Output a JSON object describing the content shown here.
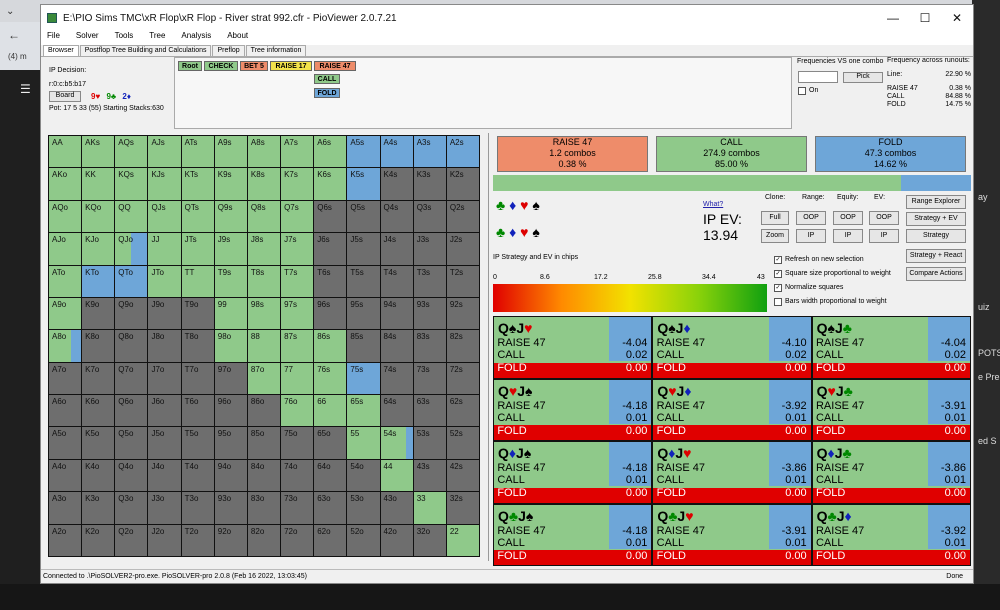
{
  "browser": {
    "tab_title": "(4) m",
    "right_snips": [
      "ay",
      "uiz",
      "POTS",
      "e Pre",
      "ed S"
    ]
  },
  "window": {
    "title": "E:\\PIO Sims TMC\\xR Flop\\xR Flop - River strat 992.cfr - PioViewer 2.0.7.21",
    "minimize": "—",
    "maximize": "☐",
    "close": "✕"
  },
  "menu": [
    "File",
    "Solver",
    "Tools",
    "Tree",
    "Analysis",
    "About"
  ],
  "tabs": [
    "Browser",
    "Postflop Tree Building and Calculations",
    "Preflop",
    "Tree information"
  ],
  "decision": {
    "label": "IP Decision:",
    "node": "r:0:c:b5:b17",
    "board_btn": "Board",
    "board_cards": [
      "9♥",
      "9♣",
      "2♦"
    ],
    "pot": "Pot: 17 5 33 (55) Starting Stacks:630"
  },
  "actions_row": [
    "Root",
    "CHECK",
    "BET 5",
    "RAISE 17",
    "RAISE 47"
  ],
  "actions_sub": [
    "CALL",
    "FOLD"
  ],
  "freq": {
    "title": "Frequencies VS one combo",
    "pick": "Pick",
    "on_label": "On"
  },
  "runouts": {
    "title": "Frequency across runouts:",
    "line_label": "Line:",
    "line_value": "22.90 %",
    "rows": [
      {
        "k": "RAISE 47",
        "v": "0.38 %"
      },
      {
        "k": "CALL",
        "v": "84.88 %"
      },
      {
        "k": "FOLD",
        "v": "14.75 %"
      }
    ]
  },
  "grid": [
    {
      "h": "AA",
      "g": 100,
      "b": 0
    },
    {
      "h": "AKs",
      "g": 100,
      "b": 0
    },
    {
      "h": "AQs",
      "g": 100,
      "b": 0
    },
    {
      "h": "AJs",
      "g": 100,
      "b": 0
    },
    {
      "h": "ATs",
      "g": 100,
      "b": 0
    },
    {
      "h": "A9s",
      "g": 100,
      "b": 0
    },
    {
      "h": "A8s",
      "g": 100,
      "b": 0
    },
    {
      "h": "A7s",
      "g": 100,
      "b": 0
    },
    {
      "h": "A6s",
      "g": 100,
      "b": 0
    },
    {
      "h": "A5s",
      "g": 0,
      "b": 100
    },
    {
      "h": "A4s",
      "g": 0,
      "b": 100
    },
    {
      "h": "A3s",
      "g": 0,
      "b": 100
    },
    {
      "h": "A2s",
      "g": 0,
      "b": 100
    },
    {
      "h": "AKo",
      "g": 100,
      "b": 0
    },
    {
      "h": "KK",
      "g": 100,
      "b": 0
    },
    {
      "h": "KQs",
      "g": 100,
      "b": 0
    },
    {
      "h": "KJs",
      "g": 100,
      "b": 0
    },
    {
      "h": "KTs",
      "g": 100,
      "b": 0
    },
    {
      "h": "K9s",
      "g": 100,
      "b": 0
    },
    {
      "h": "K8s",
      "g": 100,
      "b": 0
    },
    {
      "h": "K7s",
      "g": 100,
      "b": 0
    },
    {
      "h": "K6s",
      "g": 100,
      "b": 0
    },
    {
      "h": "K5s",
      "g": 0,
      "b": 100
    },
    {
      "h": "K4s",
      "g": 0,
      "b": 0
    },
    {
      "h": "K3s",
      "g": 0,
      "b": 0
    },
    {
      "h": "K2s",
      "g": 0,
      "b": 0
    },
    {
      "h": "AQo",
      "g": 100,
      "b": 0
    },
    {
      "h": "KQo",
      "g": 100,
      "b": 0
    },
    {
      "h": "QQ",
      "g": 100,
      "b": 0
    },
    {
      "h": "QJs",
      "g": 100,
      "b": 0
    },
    {
      "h": "QTs",
      "g": 100,
      "b": 0
    },
    {
      "h": "Q9s",
      "g": 100,
      "b": 0
    },
    {
      "h": "Q8s",
      "g": 100,
      "b": 0
    },
    {
      "h": "Q7s",
      "g": 100,
      "b": 0
    },
    {
      "h": "Q6s",
      "g": 0,
      "b": 0
    },
    {
      "h": "Q5s",
      "g": 0,
      "b": 0
    },
    {
      "h": "Q4s",
      "g": 0,
      "b": 0
    },
    {
      "h": "Q3s",
      "g": 0,
      "b": 0
    },
    {
      "h": "Q2s",
      "g": 0,
      "b": 0
    },
    {
      "h": "AJo",
      "g": 100,
      "b": 0
    },
    {
      "h": "KJo",
      "g": 100,
      "b": 0
    },
    {
      "h": "QJo",
      "g": 50,
      "b": 50
    },
    {
      "h": "JJ",
      "g": 100,
      "b": 0
    },
    {
      "h": "JTs",
      "g": 100,
      "b": 0
    },
    {
      "h": "J9s",
      "g": 100,
      "b": 0
    },
    {
      "h": "J8s",
      "g": 100,
      "b": 0
    },
    {
      "h": "J7s",
      "g": 100,
      "b": 0
    },
    {
      "h": "J6s",
      "g": 0,
      "b": 0
    },
    {
      "h": "J5s",
      "g": 0,
      "b": 0
    },
    {
      "h": "J4s",
      "g": 0,
      "b": 0
    },
    {
      "h": "J3s",
      "g": 0,
      "b": 0
    },
    {
      "h": "J2s",
      "g": 0,
      "b": 0
    },
    {
      "h": "ATo",
      "g": 100,
      "b": 0
    },
    {
      "h": "KTo",
      "g": 0,
      "b": 100
    },
    {
      "h": "QTo",
      "g": 0,
      "b": 100
    },
    {
      "h": "JTo",
      "g": 100,
      "b": 0
    },
    {
      "h": "TT",
      "g": 100,
      "b": 0
    },
    {
      "h": "T9s",
      "g": 100,
      "b": 0
    },
    {
      "h": "T8s",
      "g": 100,
      "b": 0
    },
    {
      "h": "T7s",
      "g": 100,
      "b": 0
    },
    {
      "h": "T6s",
      "g": 0,
      "b": 0
    },
    {
      "h": "T5s",
      "g": 0,
      "b": 0
    },
    {
      "h": "T4s",
      "g": 0,
      "b": 0
    },
    {
      "h": "T3s",
      "g": 0,
      "b": 0
    },
    {
      "h": "T2s",
      "g": 0,
      "b": 0
    },
    {
      "h": "A9o",
      "g": 100,
      "b": 0
    },
    {
      "h": "K9o",
      "g": 0,
      "b": 0
    },
    {
      "h": "Q9o",
      "g": 0,
      "b": 0
    },
    {
      "h": "J9o",
      "g": 0,
      "b": 0
    },
    {
      "h": "T9o",
      "g": 0,
      "b": 0
    },
    {
      "h": "99",
      "g": 100,
      "b": 0
    },
    {
      "h": "98s",
      "g": 100,
      "b": 0
    },
    {
      "h": "97s",
      "g": 100,
      "b": 0
    },
    {
      "h": "96s",
      "g": 0,
      "b": 0
    },
    {
      "h": "95s",
      "g": 0,
      "b": 0
    },
    {
      "h": "94s",
      "g": 0,
      "b": 0
    },
    {
      "h": "93s",
      "g": 0,
      "b": 0
    },
    {
      "h": "92s",
      "g": 0,
      "b": 0
    },
    {
      "h": "A8o",
      "g": 70,
      "b": 30
    },
    {
      "h": "K8o",
      "g": 0,
      "b": 0
    },
    {
      "h": "Q8o",
      "g": 0,
      "b": 0
    },
    {
      "h": "J8o",
      "g": 0,
      "b": 0
    },
    {
      "h": "T8o",
      "g": 0,
      "b": 0
    },
    {
      "h": "98o",
      "g": 100,
      "b": 0
    },
    {
      "h": "88",
      "g": 100,
      "b": 0
    },
    {
      "h": "87s",
      "g": 100,
      "b": 0
    },
    {
      "h": "86s",
      "g": 100,
      "b": 0
    },
    {
      "h": "85s",
      "g": 0,
      "b": 0
    },
    {
      "h": "84s",
      "g": 0,
      "b": 0
    },
    {
      "h": "83s",
      "g": 0,
      "b": 0
    },
    {
      "h": "82s",
      "g": 0,
      "b": 0
    },
    {
      "h": "A7o",
      "g": 0,
      "b": 0
    },
    {
      "h": "K7o",
      "g": 0,
      "b": 0
    },
    {
      "h": "Q7o",
      "g": 0,
      "b": 0
    },
    {
      "h": "J7o",
      "g": 0,
      "b": 0
    },
    {
      "h": "T7o",
      "g": 0,
      "b": 0
    },
    {
      "h": "97o",
      "g": 0,
      "b": 0
    },
    {
      "h": "87o",
      "g": 100,
      "b": 0
    },
    {
      "h": "77",
      "g": 100,
      "b": 0
    },
    {
      "h": "76s",
      "g": 100,
      "b": 0
    },
    {
      "h": "75s",
      "g": 0,
      "b": 100
    },
    {
      "h": "74s",
      "g": 0,
      "b": 0
    },
    {
      "h": "73s",
      "g": 0,
      "b": 0
    },
    {
      "h": "72s",
      "g": 0,
      "b": 0
    },
    {
      "h": "A6o",
      "g": 0,
      "b": 0
    },
    {
      "h": "K6o",
      "g": 0,
      "b": 0
    },
    {
      "h": "Q6o",
      "g": 0,
      "b": 0
    },
    {
      "h": "J6o",
      "g": 0,
      "b": 0
    },
    {
      "h": "T6o",
      "g": 0,
      "b": 0
    },
    {
      "h": "96o",
      "g": 0,
      "b": 0
    },
    {
      "h": "86o",
      "g": 0,
      "b": 0
    },
    {
      "h": "76o",
      "g": 100,
      "b": 0
    },
    {
      "h": "66",
      "g": 100,
      "b": 0
    },
    {
      "h": "65s",
      "g": 100,
      "b": 0
    },
    {
      "h": "64s",
      "g": 0,
      "b": 0
    },
    {
      "h": "63s",
      "g": 0,
      "b": 0
    },
    {
      "h": "62s",
      "g": 0,
      "b": 0
    },
    {
      "h": "A5o",
      "g": 0,
      "b": 0
    },
    {
      "h": "K5o",
      "g": 0,
      "b": 0
    },
    {
      "h": "Q5o",
      "g": 0,
      "b": 0
    },
    {
      "h": "J5o",
      "g": 0,
      "b": 0
    },
    {
      "h": "T5o",
      "g": 0,
      "b": 0
    },
    {
      "h": "95o",
      "g": 0,
      "b": 0
    },
    {
      "h": "85o",
      "g": 0,
      "b": 0
    },
    {
      "h": "75o",
      "g": 0,
      "b": 0
    },
    {
      "h": "65o",
      "g": 0,
      "b": 0
    },
    {
      "h": "55",
      "g": 100,
      "b": 0
    },
    {
      "h": "54s",
      "g": 80,
      "b": 20
    },
    {
      "h": "53s",
      "g": 0,
      "b": 0
    },
    {
      "h": "52s",
      "g": 0,
      "b": 0
    },
    {
      "h": "A4o",
      "g": 0,
      "b": 0
    },
    {
      "h": "K4o",
      "g": 0,
      "b": 0
    },
    {
      "h": "Q4o",
      "g": 0,
      "b": 0
    },
    {
      "h": "J4o",
      "g": 0,
      "b": 0
    },
    {
      "h": "T4o",
      "g": 0,
      "b": 0
    },
    {
      "h": "94o",
      "g": 0,
      "b": 0
    },
    {
      "h": "84o",
      "g": 0,
      "b": 0
    },
    {
      "h": "74o",
      "g": 0,
      "b": 0
    },
    {
      "h": "64o",
      "g": 0,
      "b": 0
    },
    {
      "h": "54o",
      "g": 0,
      "b": 0
    },
    {
      "h": "44",
      "g": 100,
      "b": 0
    },
    {
      "h": "43s",
      "g": 0,
      "b": 0
    },
    {
      "h": "42s",
      "g": 0,
      "b": 0
    },
    {
      "h": "A3o",
      "g": 0,
      "b": 0
    },
    {
      "h": "K3o",
      "g": 0,
      "b": 0
    },
    {
      "h": "Q3o",
      "g": 0,
      "b": 0
    },
    {
      "h": "J3o",
      "g": 0,
      "b": 0
    },
    {
      "h": "T3o",
      "g": 0,
      "b": 0
    },
    {
      "h": "93o",
      "g": 0,
      "b": 0
    },
    {
      "h": "83o",
      "g": 0,
      "b": 0
    },
    {
      "h": "73o",
      "g": 0,
      "b": 0
    },
    {
      "h": "63o",
      "g": 0,
      "b": 0
    },
    {
      "h": "53o",
      "g": 0,
      "b": 0
    },
    {
      "h": "43o",
      "g": 0,
      "b": 0
    },
    {
      "h": "33",
      "g": 100,
      "b": 0
    },
    {
      "h": "32s",
      "g": 0,
      "b": 0
    },
    {
      "h": "A2o",
      "g": 0,
      "b": 0
    },
    {
      "h": "K2o",
      "g": 0,
      "b": 0
    },
    {
      "h": "Q2o",
      "g": 0,
      "b": 0
    },
    {
      "h": "J2o",
      "g": 0,
      "b": 0
    },
    {
      "h": "T2o",
      "g": 0,
      "b": 0
    },
    {
      "h": "92o",
      "g": 0,
      "b": 0
    },
    {
      "h": "82o",
      "g": 0,
      "b": 0
    },
    {
      "h": "72o",
      "g": 0,
      "b": 0
    },
    {
      "h": "62o",
      "g": 0,
      "b": 0
    },
    {
      "h": "52o",
      "g": 0,
      "b": 0
    },
    {
      "h": "42o",
      "g": 0,
      "b": 0
    },
    {
      "h": "32o",
      "g": 0,
      "b": 0
    },
    {
      "h": "22",
      "g": 100,
      "b": 0
    }
  ],
  "summary": [
    {
      "name": "RAISE 47",
      "combos": "1.2 combos",
      "pct": "0.38 %",
      "color": "#ee8c6a"
    },
    {
      "name": "CALL",
      "combos": "274.9 combos",
      "pct": "85.00 %",
      "color": "#8fc98a"
    },
    {
      "name": "FOLD",
      "combos": "47.3 combos",
      "pct": "14.62 %",
      "color": "#6ea6d8"
    }
  ],
  "filter_suits": [
    [
      "♣",
      "♦",
      "♥",
      "♠"
    ],
    [
      "♣",
      "♦",
      "♥",
      "♠"
    ]
  ],
  "ev": {
    "what": "What?",
    "label": "IP EV:",
    "value": "13.94",
    "chips_label": "IP Strategy and EV in chips",
    "ticks": [
      "0",
      "8.6",
      "17.2",
      "25.8",
      "34.4",
      "43"
    ]
  },
  "controls": {
    "clone": "Clone:",
    "range": "Range:",
    "equity": "Equity:",
    "ev": "EV:",
    "full": "Full",
    "zoom": "Zoom",
    "oop": "OOP",
    "ip": "IP",
    "range_explorer": "Range Explorer",
    "strategy_ev": "Strategy + EV",
    "strategy": "Strategy",
    "strategy_react": "Strategy + React",
    "compare": "Compare Actions"
  },
  "options": [
    {
      "label": "Refresh on new selection",
      "checked": true
    },
    {
      "label": "Square size proportional to weight",
      "checked": true
    },
    {
      "label": "Normalize squares",
      "checked": true
    },
    {
      "label": "Bars width proportional to weight",
      "checked": false
    }
  ],
  "hands": [
    {
      "c": [
        [
          "Q",
          "♠",
          "#000"
        ],
        [
          "J",
          "♥",
          "#d00"
        ]
      ],
      "r": "-4.04",
      "c2": "0.02",
      "f": "0.00"
    },
    {
      "c": [
        [
          "Q",
          "♠",
          "#000"
        ],
        [
          "J",
          "♦",
          "#12b"
        ]
      ],
      "r": "-4.10",
      "c2": "0.02",
      "f": "0.00"
    },
    {
      "c": [
        [
          "Q",
          "♠",
          "#000"
        ],
        [
          "J",
          "♣",
          "#080"
        ]
      ],
      "r": "-4.04",
      "c2": "0.02",
      "f": "0.00"
    },
    {
      "c": [
        [
          "Q",
          "♥",
          "#d00"
        ],
        [
          "J",
          "♠",
          "#000"
        ]
      ],
      "r": "-4.18",
      "c2": "0.01",
      "f": "0.00"
    },
    {
      "c": [
        [
          "Q",
          "♥",
          "#d00"
        ],
        [
          "J",
          "♦",
          "#12b"
        ]
      ],
      "r": "-3.92",
      "c2": "0.01",
      "f": "0.00"
    },
    {
      "c": [
        [
          "Q",
          "♥",
          "#d00"
        ],
        [
          "J",
          "♣",
          "#080"
        ]
      ],
      "r": "-3.91",
      "c2": "0.01",
      "f": "0.00"
    },
    {
      "c": [
        [
          "Q",
          "♦",
          "#12b"
        ],
        [
          "J",
          "♠",
          "#000"
        ]
      ],
      "r": "-4.18",
      "c2": "0.01",
      "f": "0.00"
    },
    {
      "c": [
        [
          "Q",
          "♦",
          "#12b"
        ],
        [
          "J",
          "♥",
          "#d00"
        ]
      ],
      "r": "-3.86",
      "c2": "0.01",
      "f": "0.00"
    },
    {
      "c": [
        [
          "Q",
          "♦",
          "#12b"
        ],
        [
          "J",
          "♣",
          "#080"
        ]
      ],
      "r": "-3.86",
      "c2": "0.01",
      "f": "0.00"
    },
    {
      "c": [
        [
          "Q",
          "♣",
          "#080"
        ],
        [
          "J",
          "♠",
          "#000"
        ]
      ],
      "r": "-4.18",
      "c2": "0.01",
      "f": "0.00"
    },
    {
      "c": [
        [
          "Q",
          "♣",
          "#080"
        ],
        [
          "J",
          "♥",
          "#d00"
        ]
      ],
      "r": "-3.91",
      "c2": "0.01",
      "f": "0.00"
    },
    {
      "c": [
        [
          "Q",
          "♣",
          "#080"
        ],
        [
          "J",
          "♦",
          "#12b"
        ]
      ],
      "r": "-3.92",
      "c2": "0.01",
      "f": "0.00"
    }
  ],
  "hand_labels": {
    "raise": "RAISE 47",
    "call": "CALL",
    "fold": "FOLD"
  },
  "status": {
    "text": "Connected to .\\PioSOLVER2-pro.exe. PioSOLVER-pro 2.0.8 (Feb 16 2022, 13:03:45)",
    "done": "Done"
  }
}
